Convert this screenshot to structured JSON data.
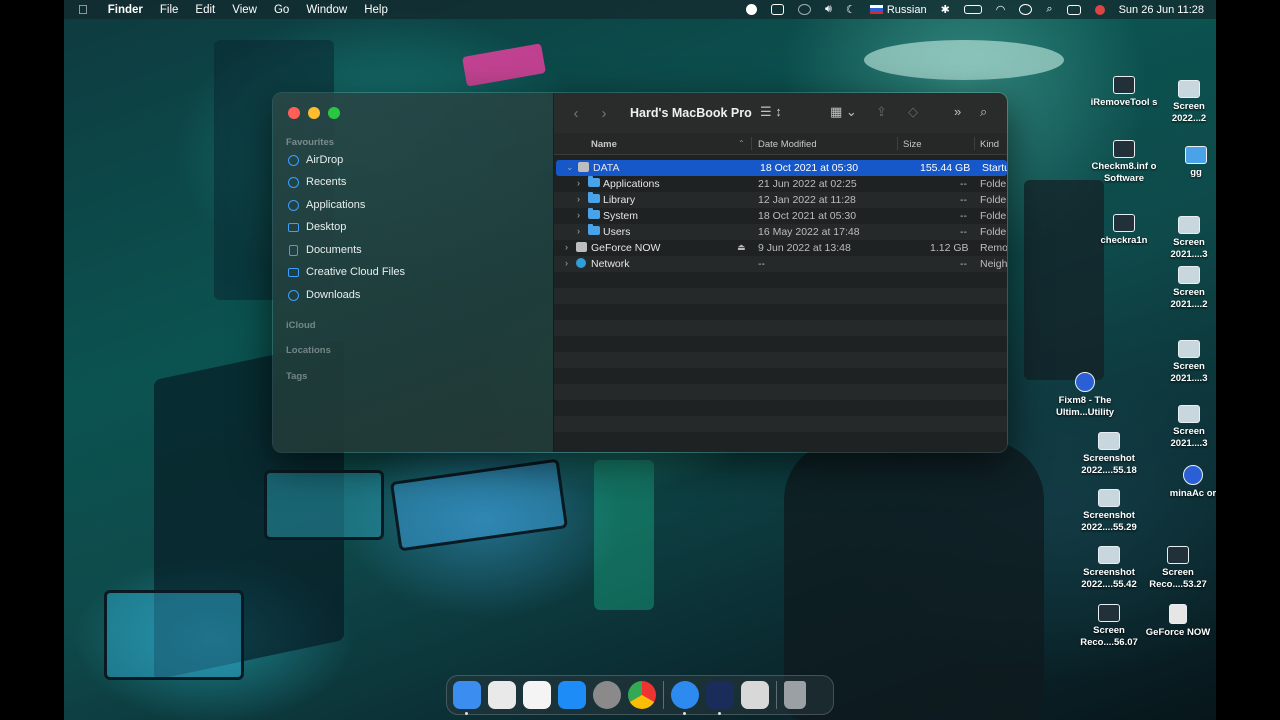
{
  "menubar": {
    "apple": "",
    "app_name": "Finder",
    "menus": [
      "File",
      "Edit",
      "View",
      "Go",
      "Window",
      "Help"
    ],
    "input_source": "Russian",
    "datetime": "Sun 26 Jun  11:28"
  },
  "finder": {
    "title": "Hard's MacBook Pro",
    "sidebar": {
      "favourites_label": "Favourites",
      "items": [
        {
          "label": "AirDrop",
          "icon": "airdrop-icon"
        },
        {
          "label": "Recents",
          "icon": "clock-icon"
        },
        {
          "label": "Applications",
          "icon": "applications-icon"
        },
        {
          "label": "Desktop",
          "icon": "desktop-icon"
        },
        {
          "label": "Documents",
          "icon": "document-icon"
        },
        {
          "label": "Creative Cloud Files",
          "icon": "folder-icon"
        },
        {
          "label": "Downloads",
          "icon": "download-icon"
        }
      ],
      "icloud_label": "iCloud",
      "locations_label": "Locations",
      "tags_label": "Tags"
    },
    "columns": {
      "name": "Name",
      "date": "Date Modified",
      "size": "Size",
      "kind": "Kind"
    },
    "rows": [
      {
        "name": "DATA",
        "date": "18 Oct 2021 at 05:30",
        "size": "155.44 GB",
        "kind": "Startu",
        "expanded": true,
        "selected": true
      },
      {
        "name": "Applications",
        "date": "21 Jun 2022 at 02:25",
        "size": "--",
        "kind": "Folde"
      },
      {
        "name": "Library",
        "date": "12 Jan 2022 at 11:28",
        "size": "--",
        "kind": "Folde"
      },
      {
        "name": "System",
        "date": "18 Oct 2021 at 05:30",
        "size": "--",
        "kind": "Folde"
      },
      {
        "name": "Users",
        "date": "16 May 2022 at 17:48",
        "size": "--",
        "kind": "Folde"
      },
      {
        "name": "GeForce NOW",
        "date": "9 Jun 2022 at 13:48",
        "size": "1.12 GB",
        "kind": "Remo"
      },
      {
        "name": "Network",
        "date": "--",
        "size": "--",
        "kind": "Neigh"
      }
    ]
  },
  "desktop_icons": [
    {
      "label": "iRemoveTool s"
    },
    {
      "label": "Screen 2022...2"
    },
    {
      "label": "Checkm8.inf o Software"
    },
    {
      "label": "gg"
    },
    {
      "label": "checkra1n"
    },
    {
      "label": "Screen 2021....3"
    },
    {
      "label": "Screen 2021....2"
    },
    {
      "label": "Fixm8 - The Ultim...Utility"
    },
    {
      "label": "Screen 2021....3"
    },
    {
      "label": "Screen 2021....3"
    },
    {
      "label": "Screenshot 2022....55.18"
    },
    {
      "label": "minaAc or"
    },
    {
      "label": "Screenshot 2022....55.29"
    },
    {
      "label": "Screenshot 2022....55.42"
    },
    {
      "label": "Screen Reco....53.27"
    },
    {
      "label": "Screen Reco....56.07"
    },
    {
      "label": "GeForce NOW"
    }
  ],
  "dock": [
    {
      "name": "finder",
      "color": "#3b8ef0"
    },
    {
      "name": "launchpad",
      "color": "#e9e9e9"
    },
    {
      "name": "reminders",
      "color": "#f4f4f4"
    },
    {
      "name": "app-store",
      "color": "#1e8cf7"
    },
    {
      "name": "system-preferences",
      "color": "#8a8a8a"
    },
    {
      "name": "chrome",
      "color": "#e9e9e9"
    },
    {
      "name": "safari",
      "color": "#2d8bf0"
    },
    {
      "name": "instruments",
      "color": "#1a2c5a"
    },
    {
      "name": "printer",
      "color": "#d8d8d8"
    },
    {
      "name": "trash",
      "color": "#9aa0a4"
    }
  ]
}
